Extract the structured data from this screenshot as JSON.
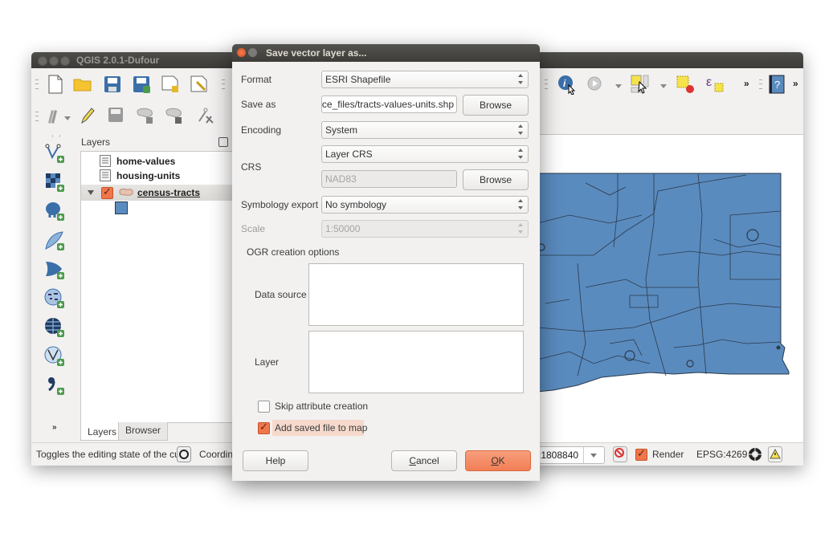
{
  "qgis_window": {
    "title": "QGIS 2.0.1-Dufour",
    "toolbar_row1_left": [
      {
        "icon": "new-project-icon",
        "label": "New Project"
      },
      {
        "icon": "open-project-icon",
        "label": "Open Project"
      },
      {
        "icon": "save-project-icon",
        "label": "Save Project"
      },
      {
        "icon": "save-project-as-icon",
        "label": "Save Project As"
      },
      {
        "icon": "new-print-composer-icon",
        "label": "New Print Composer"
      },
      {
        "icon": "composer-manager-icon",
        "label": "Composer Manager"
      }
    ],
    "toolbar_row1_right": [
      {
        "icon": "identify-features-icon"
      },
      {
        "icon": "run-feature-action-icon"
      },
      {
        "icon": "select-features-icon"
      },
      {
        "icon": "deselect-features-icon"
      },
      {
        "icon": "select-by-expression-icon"
      },
      {
        "icon": "overflow-chevron-icon",
        "label": "»"
      },
      {
        "icon": "help-contents-icon"
      },
      {
        "icon": "overflow-chevron-icon",
        "label": "»"
      }
    ],
    "toolbar_row2": [
      {
        "icon": "current-edits-icon"
      },
      {
        "icon": "toggle-editing-icon"
      },
      {
        "icon": "save-layer-edits-icon"
      },
      {
        "icon": "add-feature-icon"
      },
      {
        "icon": "move-feature-icon"
      },
      {
        "icon": "node-tool-icon"
      }
    ],
    "left_toolbar": [
      {
        "icon": "add-vector-layer-icon"
      },
      {
        "icon": "add-raster-layer-icon"
      },
      {
        "icon": "add-postgis-layer-icon"
      },
      {
        "icon": "add-spatialite-layer-icon"
      },
      {
        "icon": "add-mssql-layer-icon"
      },
      {
        "icon": "add-wms-layer-icon"
      },
      {
        "icon": "add-wcs-layer-icon"
      },
      {
        "icon": "add-wfs-layer-icon"
      },
      {
        "icon": "add-delimited-text-layer-icon"
      }
    ],
    "layers_panel": {
      "title": "Layers",
      "layers": [
        {
          "name": "home-values",
          "type": "table"
        },
        {
          "name": "housing-units",
          "type": "table"
        },
        {
          "name": "census-tracts",
          "type": "polygon",
          "checked": true,
          "expanded": true
        }
      ],
      "symbol_color": "#5a8bbf"
    },
    "panel_tabs": [
      {
        "label": "Layers",
        "active": true
      },
      {
        "label": "Browser",
        "active": false
      }
    ],
    "map": {
      "fill_color": "#5a8bbf",
      "stroke_color": "#2b3a4a"
    },
    "statusbar": {
      "message": "Toggles the editing state of the cu",
      "coordinate_label": "Coordina",
      "scale_value": ":1808840",
      "render_label": "Render",
      "render_checked": true,
      "crs": "EPSG:4269"
    }
  },
  "dialog": {
    "title": "Save vector layer as...",
    "format": {
      "label": "Format",
      "value": "ESRI Shapefile"
    },
    "save_as": {
      "label": "Save as",
      "value": "urce_files/tracts-values-units.shp",
      "browse_label": "Browse"
    },
    "encoding": {
      "label": "Encoding",
      "value": "System"
    },
    "crs": {
      "label": "CRS",
      "mode_value": "Layer CRS",
      "crs_value": "NAD83",
      "browse_label": "Browse"
    },
    "symbology_export": {
      "label": "Symbology export",
      "value": "No symbology"
    },
    "scale": {
      "label": "Scale",
      "value": "1:50000",
      "enabled": false
    },
    "ogr_options": {
      "title": "OGR creation options",
      "data_source_label": "Data source",
      "data_source_value": "",
      "layer_label": "Layer",
      "layer_value": ""
    },
    "skip_attribute_creation": {
      "label": "Skip attribute creation",
      "checked": false
    },
    "add_saved_file_to_map": {
      "label": "Add saved file to map",
      "checked": true
    },
    "buttons": {
      "help": "Help",
      "cancel_pre": "",
      "cancel_mnemonic": "C",
      "cancel_post": "ancel",
      "ok_mnemonic": "O",
      "ok_post": "K"
    },
    "accent_color": "#f0764b"
  }
}
